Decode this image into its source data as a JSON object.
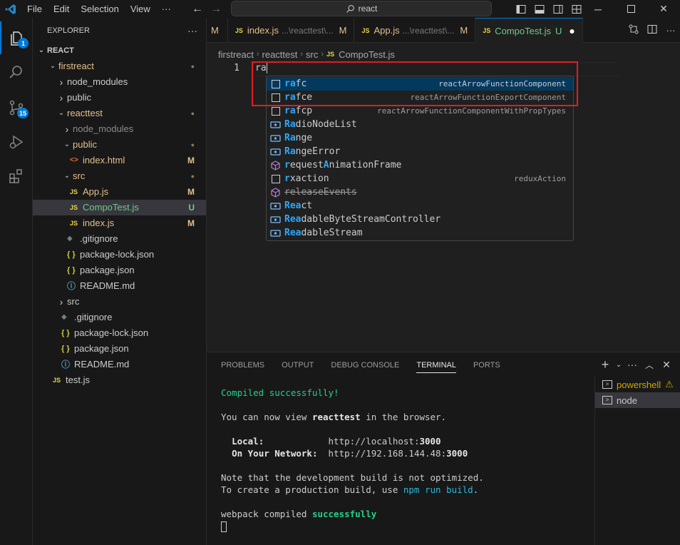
{
  "titlebar": {
    "menu": [
      "File",
      "Edit",
      "Selection",
      "View",
      "···"
    ],
    "search": "react"
  },
  "activity": {
    "scm_badge": "15",
    "explorer_badge": "1"
  },
  "sidebar": {
    "title": "EXPLORER",
    "more": "···",
    "section": "REACT",
    "items": [
      {
        "label": "firstreact",
        "type": "folder-open",
        "status": "dot",
        "level": 0
      },
      {
        "label": "node_modules",
        "type": "folder",
        "level": 1
      },
      {
        "label": "public",
        "type": "folder",
        "level": 1
      },
      {
        "label": "reacttest",
        "type": "folder-open",
        "status": "dot",
        "level": 1
      },
      {
        "label": "node_modules",
        "type": "folder-dim",
        "level": 2
      },
      {
        "label": "public",
        "type": "folder-open",
        "status": "dot",
        "level": 2
      },
      {
        "label": "index.html",
        "type": "html",
        "status": "M",
        "level": 3
      },
      {
        "label": "src",
        "type": "folder-open",
        "status": "dot",
        "level": 2
      },
      {
        "label": "App.js",
        "type": "js",
        "status": "M",
        "level": 3
      },
      {
        "label": "CompoTest.js",
        "type": "js",
        "status": "U",
        "level": 3
      },
      {
        "label": "index.js",
        "type": "js",
        "status": "M",
        "level": 3
      },
      {
        "label": ".gitignore",
        "type": "git",
        "level": 2
      },
      {
        "label": "package-lock.json",
        "type": "json",
        "level": 2
      },
      {
        "label": "package.json",
        "type": "json",
        "level": 2
      },
      {
        "label": "README.md",
        "type": "info",
        "level": 2
      },
      {
        "label": "src",
        "type": "folder",
        "level": 1
      },
      {
        "label": ".gitignore",
        "type": "git",
        "level": 1
      },
      {
        "label": "package-lock.json",
        "type": "json",
        "level": 1
      },
      {
        "label": "package.json",
        "type": "json",
        "level": 1
      },
      {
        "label": "README.md",
        "type": "info",
        "level": 1
      },
      {
        "label": "test.js",
        "type": "js",
        "level": 0
      }
    ]
  },
  "tabs": [
    {
      "label": "M",
      "path": "",
      "status": "",
      "active": false
    },
    {
      "label": "index.js",
      "path": "...\\reacttest\\...",
      "status": "M",
      "active": false
    },
    {
      "label": "App.js",
      "path": "...\\reacttest\\...",
      "status": "M",
      "active": false
    },
    {
      "label": "CompoTest.js",
      "path": "",
      "status": "U",
      "active": true
    }
  ],
  "breadcrumb": [
    "firstreact",
    "reacttest",
    "src",
    "CompoTest.js"
  ],
  "editor": {
    "line_number": "1",
    "code": "ra"
  },
  "suggestions": [
    {
      "match": "ra",
      "rest": "fc",
      "detail": "reactArrowFunctionComponent",
      "icon": "snippet",
      "focused": true
    },
    {
      "match": "ra",
      "rest": "fce",
      "detail": "reactArrowFunctionExportComponent",
      "icon": "snippet"
    },
    {
      "match": "ra",
      "rest": "fcp",
      "detail": "reactArrowFunctionComponentWithPropTypes",
      "icon": "snippet"
    },
    {
      "match": "Ra",
      "rest": "dioNodeList",
      "detail": "",
      "icon": "variable"
    },
    {
      "match": "Ra",
      "rest": "nge",
      "detail": "",
      "icon": "variable"
    },
    {
      "match": "Ra",
      "rest": "ngeError",
      "detail": "",
      "icon": "variable"
    },
    {
      "match": "r",
      "rest": "equestAnimationFrame",
      "detail": "",
      "icon": "method",
      "mid": "A"
    },
    {
      "match": "r",
      "rest": "xaction",
      "detail": "reduxAction",
      "icon": "snippet"
    },
    {
      "match": "",
      "rest": "releaseEvents",
      "detail": "",
      "icon": "method",
      "strike": true
    },
    {
      "match": "Rea",
      "rest": "ct",
      "detail": "",
      "icon": "variable"
    },
    {
      "match": "Rea",
      "rest": "dableByteStreamController",
      "detail": "",
      "icon": "variable"
    },
    {
      "match": "Rea",
      "rest": "dableStream",
      "detail": "",
      "icon": "variable"
    }
  ],
  "panel": {
    "tabs": [
      "PROBLEMS",
      "OUTPUT",
      "DEBUG CONSOLE",
      "TERMINAL",
      "PORTS"
    ],
    "active_tab": "TERMINAL",
    "terminals": [
      "powershell",
      "node"
    ],
    "output": {
      "compiled": "Compiled successfully!",
      "view_prefix": "You can now view ",
      "app": "reacttest",
      "view_suffix": " in the browser.",
      "local_label": "Local:",
      "local_url_prefix": "http://localhost:",
      "local_port": "3000",
      "network_label": "On Your Network:",
      "network_url_prefix": "http://192.168.144.48:",
      "network_port": "3000",
      "note1": "Note that the development build is not optimized.",
      "note2_prefix": "To create a production build, use ",
      "note2_cmd": "npm run build",
      "note2_suffix": ".",
      "webpack_prefix": "webpack compiled ",
      "webpack_status": "successfully"
    }
  }
}
